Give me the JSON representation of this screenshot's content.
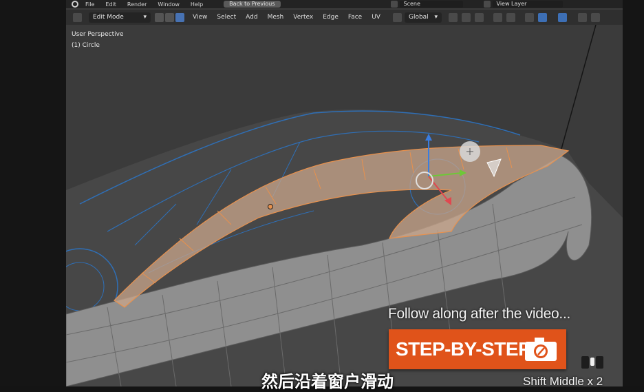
{
  "menubar": {
    "items": [
      "File",
      "Edit",
      "Render",
      "Window",
      "Help"
    ],
    "back_button": "Back to Previous",
    "scene_name": "Scene",
    "view_layer": "View Layer"
  },
  "toolbar": {
    "mode": "Edit Mode",
    "menus": [
      "View",
      "Select",
      "Add",
      "Mesh",
      "Vertex",
      "Edge",
      "Face",
      "UV"
    ],
    "transform_orientation": "Global"
  },
  "viewport": {
    "perspective_label": "User Perspective",
    "object_label": "(1) Circle"
  },
  "tutorial_overlay": {
    "follow_text": "Follow along after the video...",
    "badge_text": "STEP-BY-STEP",
    "subtitle": "然后沿着窗户滑动",
    "keystroke": "Shift Middle x 2"
  },
  "colors": {
    "selection_orange": "#e8914d",
    "wire_blue": "#2f6fb6",
    "badge_orange": "#e0531a",
    "viewport_bg": "#3b3b3b"
  }
}
